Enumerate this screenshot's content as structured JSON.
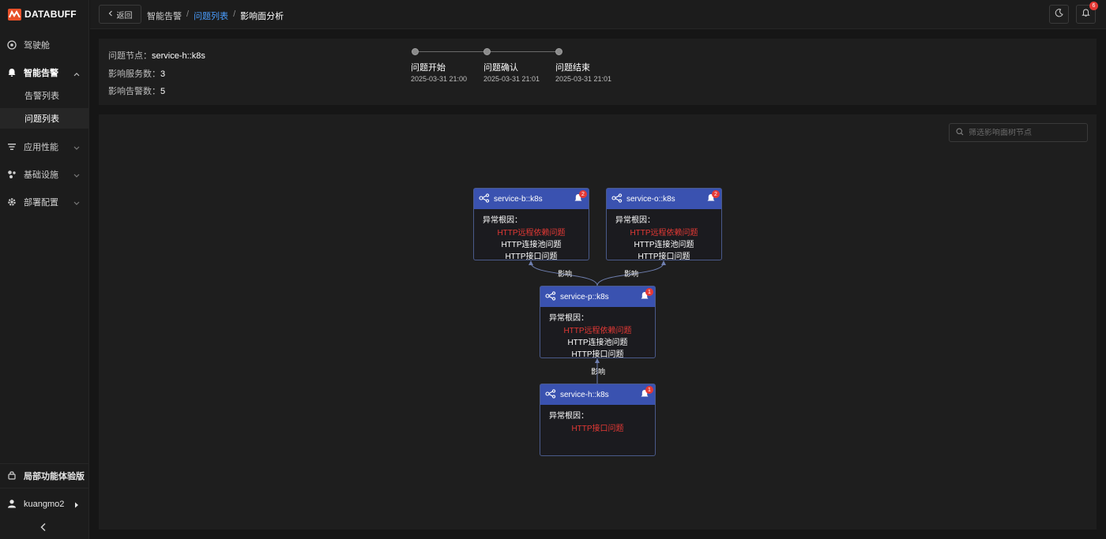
{
  "app": {
    "logo_text": "DATABUFF"
  },
  "sidebar": {
    "items": [
      {
        "label": "驾驶舱",
        "icon": "cockpit-icon"
      },
      {
        "label": "智能告警",
        "icon": "bell-icon",
        "expanded": true,
        "children": [
          {
            "label": "告警列表"
          },
          {
            "label": "问题列表",
            "selected": true
          }
        ]
      },
      {
        "label": "应用性能",
        "icon": "app-performance-icon"
      },
      {
        "label": "基础设施",
        "icon": "infrastructure-icon"
      },
      {
        "label": "部署配置",
        "icon": "gear-icon"
      }
    ],
    "trial_label": "局部功能体验版",
    "username": "kuangmo2"
  },
  "topbar": {
    "back_label": "返回",
    "breadcrumb": [
      "智能告警",
      "问题列表",
      "影响面分析"
    ],
    "notification_count": "6"
  },
  "info": {
    "problem_node_label": "问题节点：",
    "problem_node": "service-h::k8s",
    "affected_services_label": "影响服务数：",
    "affected_services": "3",
    "affected_alerts_label": "影响告警数：",
    "affected_alerts": "5",
    "steps": [
      {
        "label": "问题开始",
        "time": "2025-03-31 21:00"
      },
      {
        "label": "问题确认",
        "time": "2025-03-31 21:01"
      },
      {
        "label": "问题结束",
        "time": "2025-03-31 21:01"
      }
    ]
  },
  "graph": {
    "search_placeholder": "筛选影响面树节点",
    "edge_label": "影响",
    "cause_heading": "异常根因：",
    "nodes": [
      {
        "id": "b",
        "title": "service-b::k8s",
        "alerts": "2",
        "causes": [
          {
            "text": "HTTP远程依赖问题",
            "highlight": true
          },
          {
            "text": "HTTP连接池问题",
            "highlight": false
          },
          {
            "text": "HTTP接口问题",
            "highlight": false
          }
        ]
      },
      {
        "id": "o",
        "title": "service-o::k8s",
        "alerts": "2",
        "causes": [
          {
            "text": "HTTP远程依赖问题",
            "highlight": true
          },
          {
            "text": "HTTP连接池问题",
            "highlight": false
          },
          {
            "text": "HTTP接口问题",
            "highlight": false
          }
        ]
      },
      {
        "id": "p",
        "title": "service-p::k8s",
        "alerts": "1",
        "causes": [
          {
            "text": "HTTP远程依赖问题",
            "highlight": true
          },
          {
            "text": "HTTP连接池问题",
            "highlight": false
          },
          {
            "text": "HTTP接口问题",
            "highlight": false
          }
        ]
      },
      {
        "id": "h",
        "title": "service-h::k8s",
        "alerts": "1",
        "causes": [
          {
            "text": "HTTP接口问题",
            "highlight": true
          }
        ]
      }
    ]
  },
  "colors": {
    "accent": "#4a9eff",
    "node_header": "#3a52b0",
    "alert_red": "#e53935",
    "brand": "#e8512a"
  }
}
